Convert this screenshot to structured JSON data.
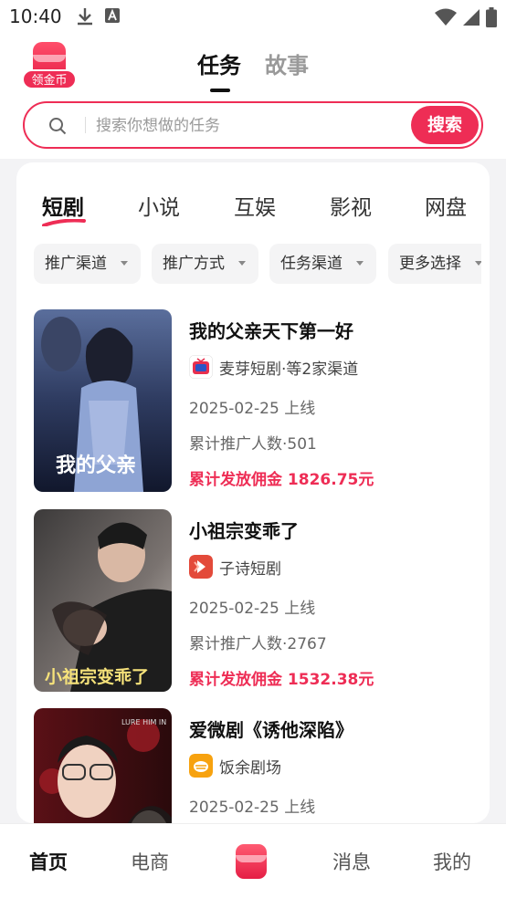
{
  "status": {
    "time": "10:40"
  },
  "header": {
    "coin_label": "领金币",
    "tabs": [
      {
        "label": "任务"
      },
      {
        "label": "故事"
      }
    ],
    "active_tab": 0,
    "search": {
      "placeholder": "搜索你想做的任务",
      "button": "搜索"
    }
  },
  "categories": [
    {
      "label": "短剧"
    },
    {
      "label": "小说"
    },
    {
      "label": "互娱"
    },
    {
      "label": "影视"
    },
    {
      "label": "网盘"
    }
  ],
  "filters": [
    {
      "label": "推广渠道"
    },
    {
      "label": "推广方式"
    },
    {
      "label": "任务渠道"
    },
    {
      "label": "更多选择"
    }
  ],
  "items": [
    {
      "title": "我的父亲天下第一好",
      "channel": "麦芽短剧·等2家渠道",
      "date": "2025-02-25 上线",
      "count": "累计推广人数·501",
      "commission": "累计发放佣金 1826.75元",
      "poster_text": "我的父亲"
    },
    {
      "title": "小祖宗变乖了",
      "channel": "子诗短剧",
      "date": "2025-02-25 上线",
      "count": "累计推广人数·2767",
      "commission": "累计发放佣金 1532.38元",
      "poster_text": "小祖宗变乖了"
    },
    {
      "title": "爱微剧《诱他深陷》",
      "channel": "饭余剧场",
      "date": "2025-02-25 上线",
      "count": "",
      "commission": "",
      "poster_text": "LURE HIM IN"
    }
  ],
  "nav": [
    {
      "label": "首页"
    },
    {
      "label": "电商"
    },
    {
      "label": "消息"
    },
    {
      "label": "我的"
    }
  ],
  "colors": {
    "accent": "#ee2d55"
  }
}
